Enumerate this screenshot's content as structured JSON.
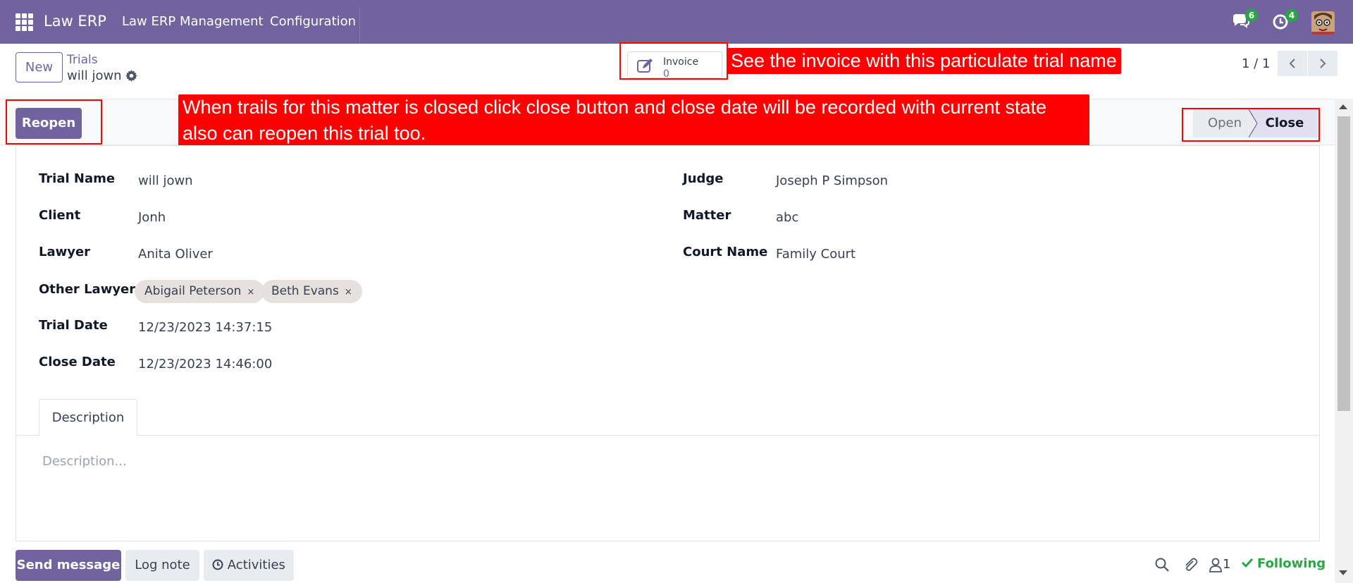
{
  "navbar": {
    "brand": "Law ERP",
    "menu": [
      "Law ERP Management",
      "Configuration"
    ],
    "messages_badge": "6",
    "activities_badge": "4",
    "bg_color": "#71639e"
  },
  "control_panel": {
    "new_label": "New",
    "breadcrumb_parent": "Trials",
    "breadcrumb_current": "will jown",
    "invoice_label": "Invoice",
    "invoice_count": "0",
    "pager": "1 / 1"
  },
  "callouts": {
    "invoice_note": "See the invoice with this particulate trial name",
    "close_note_line1": "When trails for this matter is closed click close button and close date will be recorded with current state",
    "close_note_line2": "also can reopen this trial too."
  },
  "statusbar": {
    "reopen_label": "Reopen",
    "stages": [
      "Open",
      "Close"
    ],
    "active_stage": "Close"
  },
  "form": {
    "left": [
      {
        "label": "Trial Name",
        "value": "will jown"
      },
      {
        "label": "Client",
        "value": "Jonh"
      },
      {
        "label": "Lawyer",
        "value": "Anita Oliver"
      },
      {
        "label": "Other Lawyer",
        "value": ""
      },
      {
        "label": "Trial Date",
        "value": "12/23/2023 14:37:15"
      },
      {
        "label": "Close Date",
        "value": "12/23/2023 14:46:00"
      }
    ],
    "other_lawyers": [
      "Abigail Peterson",
      "Beth Evans"
    ],
    "tag_remove": "×",
    "right": [
      {
        "label": "Judge",
        "value": "Joseph P Simpson"
      },
      {
        "label": "Matter",
        "value": "abc"
      },
      {
        "label": "Court Name",
        "value": "Family Court"
      }
    ],
    "tab_label": "Description",
    "description_placeholder": "Description..."
  },
  "chatter": {
    "send_message": "Send message",
    "log_note": "Log note",
    "activities": "Activities",
    "followers_count": "1",
    "following": "Following",
    "icons": [
      "search-icon",
      "paperclip-icon",
      "user-icon"
    ]
  }
}
